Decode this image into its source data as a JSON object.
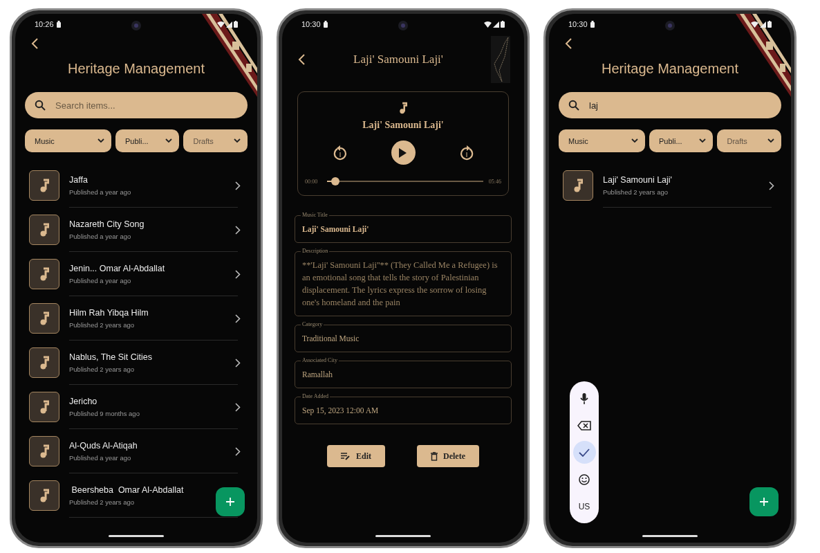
{
  "screens": [
    {
      "kind": "list",
      "time": "10:26",
      "title": "Heritage Management",
      "search": {
        "placeholder": "Search items..."
      },
      "filters": [
        {
          "label": "Music",
          "kind": "value"
        },
        {
          "label": "Publi...",
          "kind": "value"
        },
        {
          "label": "Drafts",
          "kind": "hint"
        }
      ],
      "items": [
        {
          "title": "Jaffa",
          "subtitle": "Published a year ago"
        },
        {
          "title": "Nazareth City Song",
          "subtitle": "Published a year ago"
        },
        {
          "title": "Jenin... Omar Al-Abdallat",
          "subtitle": "Published a year ago"
        },
        {
          "title": "Hilm Rah Yibqa Hilm",
          "subtitle": "Published 2 years ago"
        },
        {
          "title": "Nablus, The Sit Cities",
          "subtitle": "Published 2 years ago"
        },
        {
          "title": "Jericho",
          "subtitle": "Published 9 months ago"
        },
        {
          "title": "Al-Quds Al-Atiqah",
          "subtitle": "Published a year ago"
        },
        {
          "title": " Beersheba  Omar Al-Abdallat",
          "subtitle": "Published 2 years ago"
        }
      ]
    },
    {
      "kind": "detail",
      "time": "10:30",
      "title": "Laji' Samouni Laji'",
      "player": {
        "title": "Laji' Samouni Laji'",
        "elapsed": "00:00",
        "duration": "05:46",
        "level": 0.05
      },
      "fields": [
        {
          "label": "Music Title",
          "value": "Laji' Samouni Laji'",
          "kind": "strong"
        },
        {
          "label": "Description",
          "value": "**'Laji' Samouni Laji''** (They Called Me a Refugee) is an emotional song that tells the story of Palestinian displacement. The lyrics express the sorrow of losing one's homeland and the pain",
          "kind": "multiline"
        },
        {
          "label": "Category",
          "value": "Traditional Music",
          "kind": "plain"
        },
        {
          "label": "Associated City",
          "value": "Ramallah",
          "kind": "plain"
        },
        {
          "label": "Date Added",
          "value": "Sep 15, 2023 12:00 AM",
          "kind": "plain"
        }
      ],
      "buttons": [
        {
          "label": "Edit",
          "kind": "edit"
        },
        {
          "label": "Delete",
          "kind": "delete"
        }
      ]
    },
    {
      "kind": "list",
      "time": "10:30",
      "title": "Heritage Management",
      "search": {
        "value": "laj"
      },
      "filters": [
        {
          "label": "Music",
          "kind": "value"
        },
        {
          "label": "Publi...",
          "kind": "value"
        },
        {
          "label": "Drafts",
          "kind": "hint"
        }
      ],
      "items": [
        {
          "title": "Laji' Samouni Laji'",
          "subtitle": "Published 2 years ago"
        }
      ],
      "keyboard_toolbar": [
        {
          "kind": "mic",
          "selected": false
        },
        {
          "kind": "backspace",
          "selected": false
        },
        {
          "kind": "check",
          "selected": true
        },
        {
          "kind": "emoji",
          "selected": false
        },
        {
          "kind": "lang",
          "label": "US",
          "selected": false
        }
      ]
    }
  ]
}
